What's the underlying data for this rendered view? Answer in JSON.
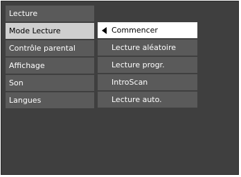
{
  "main_menu": {
    "items": [
      {
        "label": "Lecture"
      },
      {
        "label": "Mode Lecture",
        "selected": true
      },
      {
        "label": "Contrôle parental"
      },
      {
        "label": "Affichage"
      },
      {
        "label": "Son"
      },
      {
        "label": "Langues"
      }
    ]
  },
  "submenu": {
    "items": [
      {
        "label": "Commencer",
        "active": true,
        "icon": "left-arrow-icon"
      },
      {
        "label": "Lecture aléatoire"
      },
      {
        "label": "Lecture progr."
      },
      {
        "label": "IntroScan"
      },
      {
        "label": "Lecture auto."
      }
    ]
  },
  "colors": {
    "background": "#3f3f3f",
    "item_bg": "#5a5a5a",
    "selected_bg": "#cfcfcf",
    "active_bg": "#ffffff",
    "text": "#ffffff",
    "text_selected": "#000000"
  }
}
